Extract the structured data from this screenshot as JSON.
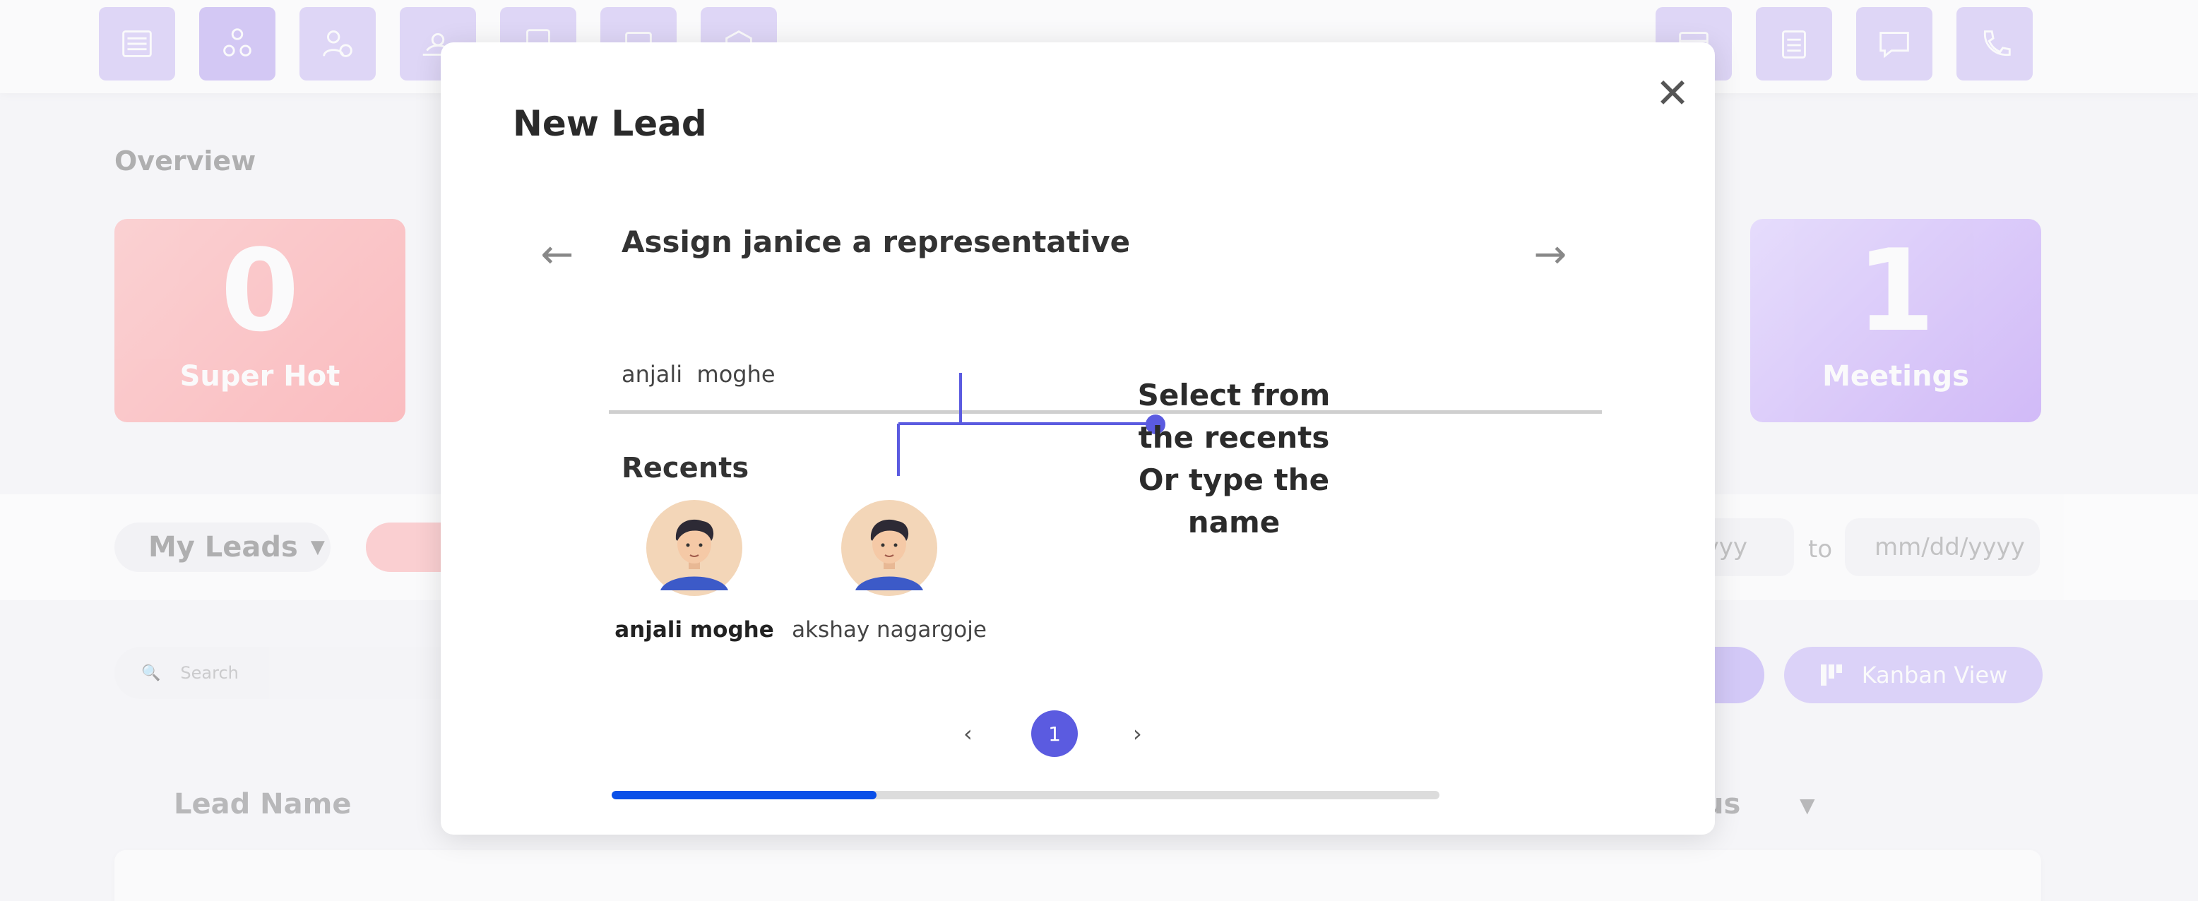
{
  "topnav": {
    "icons": [
      "list-icon",
      "team-icon",
      "user-clock-icon",
      "weather-icon",
      "report-icon",
      "calendar-icon",
      "box-icon",
      "table-icon",
      "clipboard-icon",
      "chat-icon",
      "phone-icon"
    ]
  },
  "overview": {
    "title": "Overview",
    "cards": [
      {
        "value": "0",
        "label": "Super Hot",
        "color": "#ff9a9e"
      },
      {
        "value": "1",
        "label": "Meetings",
        "color": "#c19bf9"
      }
    ]
  },
  "filters": {
    "my_leads": "My Leads",
    "date_from_placeholder": "mm/dd/yyyy",
    "date_from_visible": "/yyyy",
    "to_label": "to",
    "date_to_placeholder": "mm/dd/yyyy",
    "search_placeholder": "Search",
    "kanban_label": "Kanban View"
  },
  "table": {
    "columns": [
      "Lead Name",
      "us"
    ]
  },
  "modal": {
    "title": "New Lead",
    "step_title": "Assign janice a representative",
    "input_value": "anjali  moghe",
    "recents_title": "Recents",
    "recents": [
      {
        "name": "anjali moghe",
        "selected": true
      },
      {
        "name": "akshay nagargoje",
        "selected": false
      }
    ],
    "hint_lines": [
      "Select from",
      "the recents",
      "Or type the",
      "name"
    ],
    "pagination": {
      "prev": "‹",
      "current": "1",
      "next": "›"
    },
    "progress": 0.32,
    "accent": "#5b5be0",
    "progress_color": "#0a4fe8"
  }
}
